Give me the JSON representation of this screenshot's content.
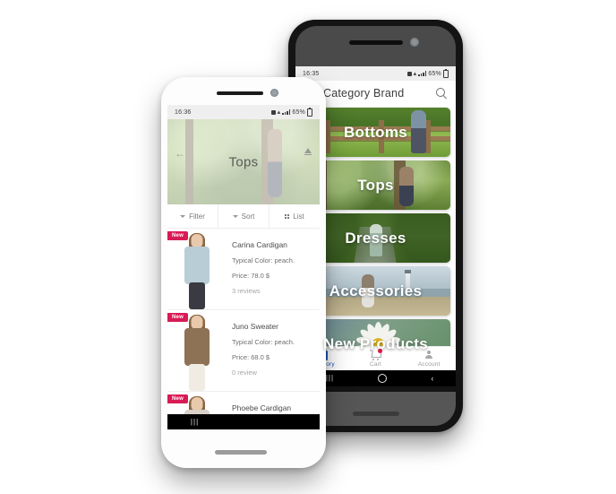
{
  "back_phone": {
    "status_bar": {
      "time": "16:35",
      "battery": "65%"
    },
    "app_bar": {
      "menu_icon": "hamburger-icon",
      "title": "Category Brand",
      "search_icon": "search-icon"
    },
    "categories": [
      {
        "label": "Bottoms"
      },
      {
        "label": "Tops"
      },
      {
        "label": "Dresses"
      },
      {
        "label": "Accessories"
      },
      {
        "label": "New Products"
      }
    ],
    "bottom_nav": {
      "active_color": "#1f56c4",
      "inactive_color": "#9a9a9a",
      "badge_color": "#e8174a",
      "items": [
        {
          "label": "Category",
          "icon": "bag-icon",
          "active": true
        },
        {
          "label": "Cart",
          "icon": "cart-icon",
          "active": false,
          "badge": true
        },
        {
          "label": "Account",
          "icon": "person-icon",
          "active": false
        }
      ]
    },
    "android_nav": {
      "recents": "recents-icon",
      "home": "home-icon",
      "back": "‹"
    }
  },
  "front_phone": {
    "status_bar": {
      "time": "16:36",
      "battery": "65%"
    },
    "hero": {
      "title": "Tops",
      "back_icon": "back-arrow-icon",
      "share_icon": "share-icon"
    },
    "toolbar": {
      "filter_label": "Filter",
      "sort_label": "Sort",
      "list_label": "List"
    },
    "badge_new_label": "New",
    "badge_new_color": "#d81b55",
    "products": [
      {
        "name": "Carina Cardigan",
        "color": "Typical Color: peach.",
        "price": "Price: 78.0 $",
        "reviews": "3 reviews"
      },
      {
        "name": "Juno Sweater",
        "color": "Typical Color: peach.",
        "price": "Price: 68.0 $",
        "reviews": "0 review"
      },
      {
        "name": "Phoebe Cardigan",
        "color": "",
        "price": "",
        "reviews": ""
      }
    ],
    "android_nav": {
      "recents": "recents-icon",
      "home": "home-icon",
      "back": "‹"
    }
  }
}
